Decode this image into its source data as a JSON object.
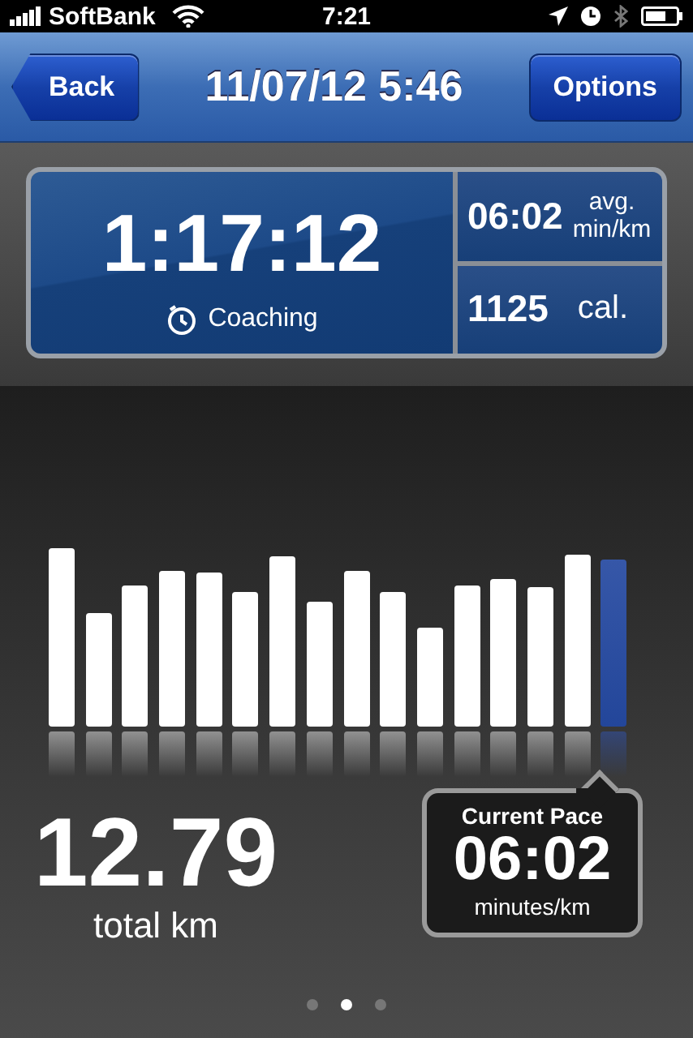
{
  "status_bar": {
    "carrier": "SoftBank",
    "time": "7:21"
  },
  "nav_bar": {
    "back": "Back",
    "title": "11/07/12 5:46",
    "options": "Options"
  },
  "stats": {
    "duration": "1:17:12",
    "coaching": "Coaching",
    "pace": "06:02",
    "pace_unit_top": "avg.",
    "pace_unit_bottom": "min/km",
    "calories": "1125",
    "calories_unit": "cal."
  },
  "pace_bars": [
    {
      "selected": false
    },
    {
      "selected": false
    },
    {
      "selected": false
    },
    {
      "selected": false
    },
    {
      "selected": false
    },
    {
      "selected": false
    },
    {
      "selected": false
    },
    {
      "selected": false
    },
    {
      "selected": false
    },
    {
      "selected": false
    },
    {
      "selected": false
    },
    {
      "selected": false
    },
    {
      "selected": false
    },
    {
      "selected": false
    },
    {
      "selected": false
    },
    {
      "selected": true
    }
  ],
  "distance": {
    "value": "12.79",
    "unit": "total km"
  },
  "current_pace": {
    "title": "Current Pace",
    "value": "06:02",
    "unit": "minutes/km"
  },
  "page_dots": [
    {
      "selected": false
    },
    {
      "selected": true
    },
    {
      "selected": false
    }
  ]
}
